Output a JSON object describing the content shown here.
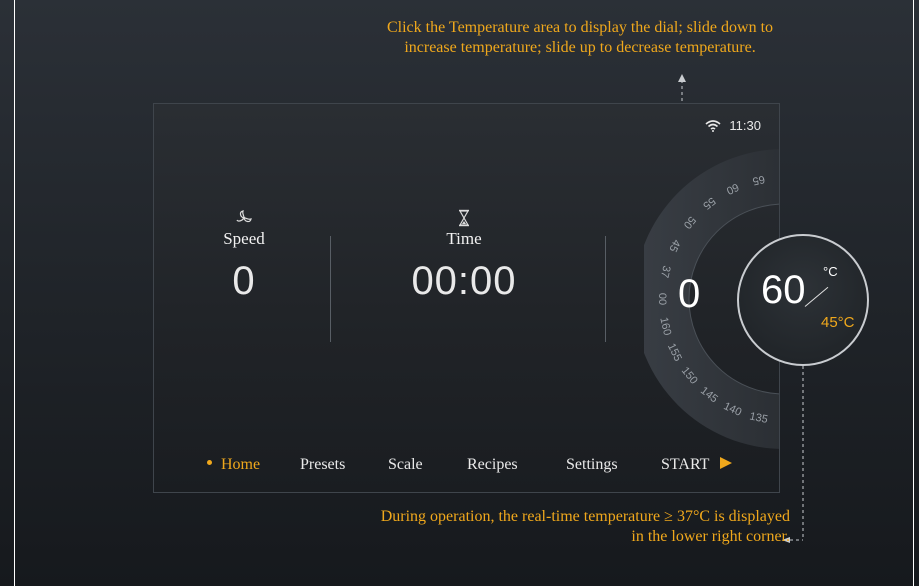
{
  "callouts": {
    "top_line1": "Click the Temperature area to display the dial; slide down to",
    "top_line2": "increase temperature; slide up to decrease temperature.",
    "bottom_line1": "During operation, the real-time temperature ≥ 37°C is displayed",
    "bottom_line2": "in the lower right corner."
  },
  "status": {
    "time": "11:30",
    "wifi_icon": "wifi-icon"
  },
  "speed": {
    "label": "Speed",
    "value": "0",
    "icon": "fan-icon"
  },
  "time": {
    "label": "Time",
    "value": "00:00",
    "icon": "hourglass-icon"
  },
  "dial": {
    "current": "0",
    "ticks": [
      "65",
      "60",
      "55",
      "50",
      "45",
      "37",
      "00",
      "160",
      "155",
      "150",
      "145",
      "140",
      "135"
    ]
  },
  "temperature": {
    "set": "60",
    "unit": "°C",
    "real": "45°C"
  },
  "nav": {
    "items": [
      "Home",
      "Presets",
      "Scale",
      "Recipes",
      "Settings"
    ],
    "active": "Home",
    "start_label": "START"
  },
  "colors": {
    "accent": "#f0a81c",
    "background": "#1f2328",
    "text": "#eaeaea"
  }
}
